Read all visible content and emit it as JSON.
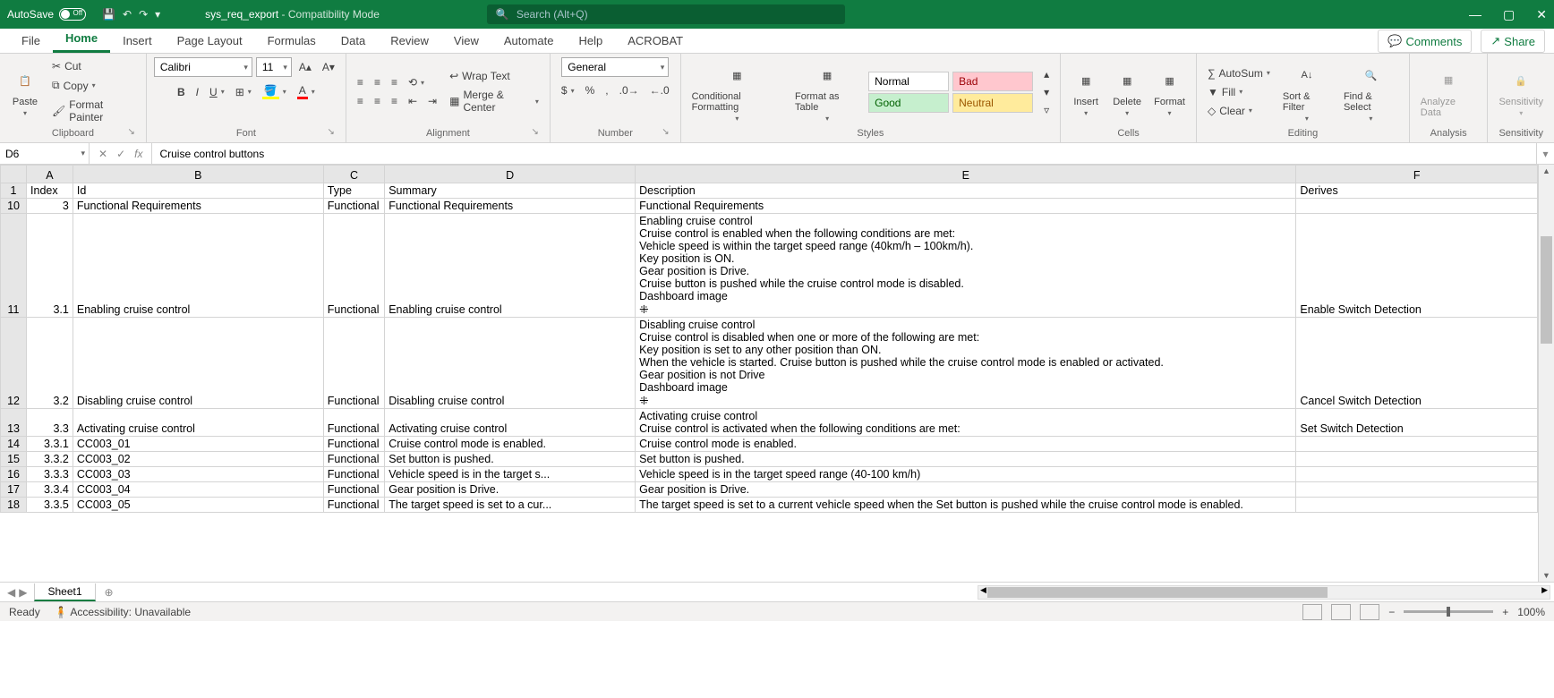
{
  "titlebar": {
    "autosave": "AutoSave",
    "autosave_state": "Off",
    "doc": "sys_req_export",
    "compat": "  -  Compatibility Mode",
    "search_placeholder": "Search (Alt+Q)"
  },
  "tabs": {
    "file": "File",
    "home": "Home",
    "insert": "Insert",
    "page_layout": "Page Layout",
    "formulas": "Formulas",
    "data": "Data",
    "review": "Review",
    "view": "View",
    "automate": "Automate",
    "help": "Help",
    "acrobat": "ACROBAT",
    "comments": "Comments",
    "share": "Share"
  },
  "ribbon": {
    "paste": "Paste",
    "cut": "Cut",
    "copy": "Copy",
    "format_painter": "Format Painter",
    "clipboard": "Clipboard",
    "font_name": "Calibri",
    "font_size": "11",
    "font": "Font",
    "alignment": "Alignment",
    "wrap": "Wrap Text",
    "merge": "Merge & Center",
    "number_format": "General",
    "number": "Number",
    "cond_fmt": "Conditional Formatting",
    "fmt_table": "Format as Table",
    "style_normal": "Normal",
    "style_bad": "Bad",
    "style_good": "Good",
    "style_neutral": "Neutral",
    "styles": "Styles",
    "insert": "Insert",
    "delete": "Delete",
    "format": "Format",
    "cells": "Cells",
    "autosum": "AutoSum",
    "fill": "Fill",
    "clear": "Clear",
    "editing": "Editing",
    "sort": "Sort & Filter",
    "find": "Find & Select",
    "analyze": "Analyze Data",
    "analysis": "Analysis",
    "sensitivity": "Sensitivity",
    "sensitivity_group": "Sensitivity"
  },
  "fbar": {
    "name": "D6",
    "fx_value": "Cruise control buttons"
  },
  "cols": [
    "A",
    "B",
    "C",
    "D",
    "E",
    "F"
  ],
  "rows": [
    {
      "r": "1",
      "A": "Index",
      "B": "Id",
      "C": "Type",
      "D": "Summary",
      "E": "Description",
      "F": "Derives"
    },
    {
      "r": "10",
      "A": "3",
      "B": "Functional Requirements",
      "C": "Functional",
      "D": "Functional Requirements",
      "E": "           Functional Requirements",
      "F": ""
    },
    {
      "r": "11",
      "A": "3.1",
      "B": "Enabling cruise control",
      "C": "Functional",
      "D": "Enabling cruise control",
      "E": "Enabling cruise control\nCruise control is enabled when the following conditions are met:\nVehicle speed is within the target speed range (40km/h – 100km/h).\nKey position is ON.\nGear position is Drive.\nCruise button is pushed while the cruise control mode is disabled.\nDashboard image\n⁜",
      "F": "Enable Switch Detection"
    },
    {
      "r": "12",
      "A": "3.2",
      "B": "Disabling cruise control",
      "C": "Functional",
      "D": "Disabling cruise control",
      "E": "Disabling cruise control\nCruise control is disabled when one or more of the following are met:\nKey position is set to any other position than ON.\nWhen the vehicle is started. Cruise button is pushed while the cruise control mode is enabled or activated.\nGear position is not Drive\nDashboard image\n⁜",
      "F": "Cancel Switch Detection"
    },
    {
      "r": "13",
      "A": "3.3",
      "B": "Activating cruise control",
      "C": "Functional",
      "D": "Activating cruise control",
      "E": "Activating cruise control\nCruise control is activated when the following conditions are met:",
      "F": "Set Switch Detection"
    },
    {
      "r": "14",
      "A": "3.3.1",
      "B": "CC003_01",
      "C": "Functional",
      "D": "Cruise control mode is enabled.",
      "E": "Cruise control mode is enabled.",
      "F": ""
    },
    {
      "r": "15",
      "A": "3.3.2",
      "B": "CC003_02",
      "C": "Functional",
      "D": "Set button is pushed.",
      "E": "Set button is pushed.",
      "F": ""
    },
    {
      "r": "16",
      "A": "3.3.3",
      "B": "CC003_03",
      "C": "Functional",
      "D": "Vehicle speed is in the target s...",
      "E": "Vehicle speed is in the target speed range (40-100 km/h)",
      "F": ""
    },
    {
      "r": "17",
      "A": "3.3.4",
      "B": "CC003_04",
      "C": "Functional",
      "D": "Gear position is Drive.",
      "E": "Gear position is Drive.",
      "F": ""
    },
    {
      "r": "18",
      "A": "3.3.5",
      "B": "CC003_05",
      "C": "Functional",
      "D": "The target speed is set to a cur...",
      "E": "The target speed is set to a current vehicle speed when the Set button is pushed while the cruise control mode is enabled.",
      "F": ""
    }
  ],
  "sheet": {
    "name": "Sheet1"
  },
  "status": {
    "ready": "Ready",
    "access": "Accessibility: Unavailable",
    "zoom": "100%"
  }
}
